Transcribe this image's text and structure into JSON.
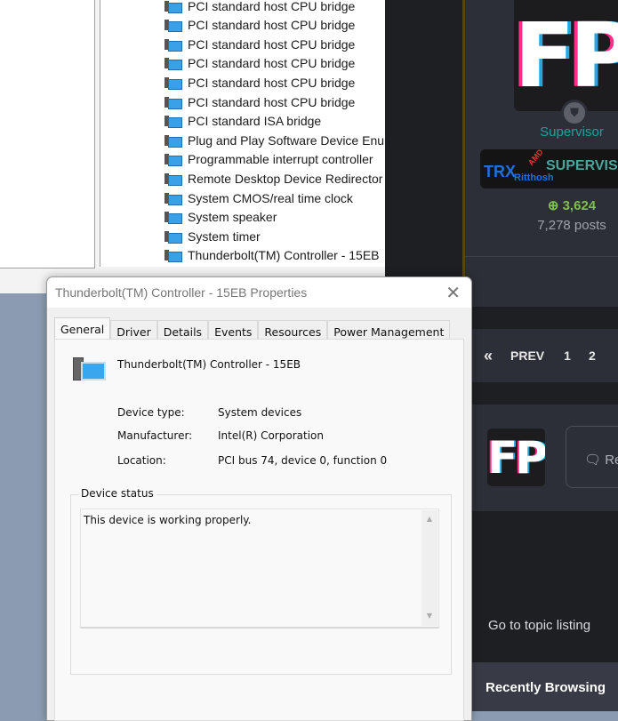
{
  "device_manager": {
    "devices": [
      "PCI standard host CPU bridge",
      "PCI standard host CPU bridge",
      "PCI standard host CPU bridge",
      "PCI standard host CPU bridge",
      "PCI standard host CPU bridge",
      "PCI standard host CPU bridge",
      "PCI standard ISA bridge",
      "Plug and Play Software Device Enumerator",
      "Programmable interrupt controller",
      "Remote Desktop Device Redirector Bus",
      "System CMOS/real time clock",
      "System speaker",
      "System timer",
      "Thunderbolt(TM) Controller - 15EB"
    ]
  },
  "dialog": {
    "title": "Thunderbolt(TM) Controller - 15EB Properties",
    "close": "✕",
    "tabs": [
      "General",
      "Driver",
      "Details",
      "Events",
      "Resources",
      "Power Management"
    ],
    "device_name": "Thunderbolt(TM) Controller - 15EB",
    "props": [
      {
        "label": "Device type:",
        "value": "System devices"
      },
      {
        "label": "Manufacturer:",
        "value": "Intel(R) Corporation"
      },
      {
        "label": "Location:",
        "value": "PCI bus 74, device 0, function 0"
      }
    ],
    "status_group": "Device status",
    "status_text": "This device is working properly."
  },
  "forum": {
    "avatar_text": "FP",
    "role": "Supervisor",
    "badge": {
      "left": "TRX",
      "sub": "Ritthosh",
      "amd": "AMD",
      "right": "SUPERVISOR"
    },
    "reputation": "3,624",
    "posts": "7,278 posts",
    "pagination": [
      "«",
      "PREV",
      "1",
      "2"
    ],
    "reply": "Re",
    "go_to_listing": "Go to topic listing",
    "recently_browsing": "Recently Browsing",
    "colors": {
      "role": "#1aa39b",
      "rep": "#7ec04a"
    }
  }
}
